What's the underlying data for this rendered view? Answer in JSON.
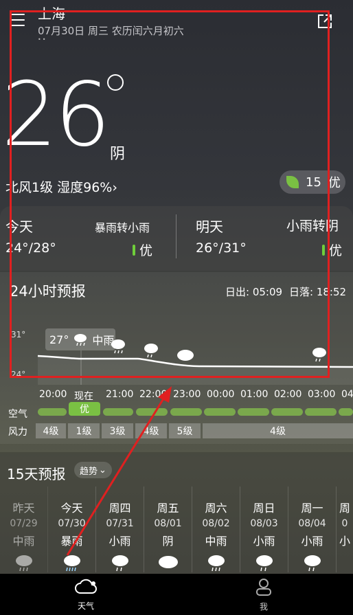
{
  "header": {
    "city": "上海",
    "date": "07月30日 周三  农历闰六月初六",
    "page_dots": "••"
  },
  "current": {
    "temp": "26",
    "condition": "阴",
    "wind_humidity": "北风1级  湿度96%›",
    "aqi_value": "15",
    "aqi_label": "优"
  },
  "today": {
    "title": "今天",
    "condition": "暴雨转小雨",
    "temps": "24°/28°",
    "quality": "优"
  },
  "tomorrow": {
    "title": "明天",
    "condition": "小雨转阴",
    "temps": "26°/31°",
    "quality": "优"
  },
  "hourly": {
    "title": "24小时预报",
    "sunrise": "日出: 05:09",
    "sunset": "日落: 18:52",
    "y_max": "31°",
    "y_min": "24°",
    "tooltip_temp": "27°",
    "tooltip_cond": "中雨",
    "hours": [
      "20:00",
      "现在",
      "21:00",
      "22:00",
      "23:00",
      "00:00",
      "01:00",
      "02:00",
      "03:00",
      "04"
    ],
    "now_aqi": "优",
    "air_label": "空气",
    "wind_label": "风力",
    "wind_levels": [
      "4级",
      "1级",
      "3级",
      "4级",
      "5级",
      "4级"
    ]
  },
  "forecast15": {
    "title": "15天预报",
    "trend_label": "趋势",
    "days": [
      {
        "day": "昨天",
        "date": "07/29",
        "cond": "中雨"
      },
      {
        "day": "今天",
        "date": "07/30",
        "cond": "暴雨"
      },
      {
        "day": "周四",
        "date": "07/31",
        "cond": "小雨"
      },
      {
        "day": "周五",
        "date": "08/01",
        "cond": "阴"
      },
      {
        "day": "周六",
        "date": "08/02",
        "cond": "中雨"
      },
      {
        "day": "周日",
        "date": "08/03",
        "cond": "小雨"
      },
      {
        "day": "周一",
        "date": "08/04",
        "cond": "小雨"
      },
      {
        "day": "周",
        "date": "0",
        "cond": "小"
      }
    ]
  },
  "nav": {
    "weather": "天气",
    "me": "我"
  },
  "colors": {
    "accent_green": "#6fcf3a",
    "annotation_red": "#e02020"
  }
}
